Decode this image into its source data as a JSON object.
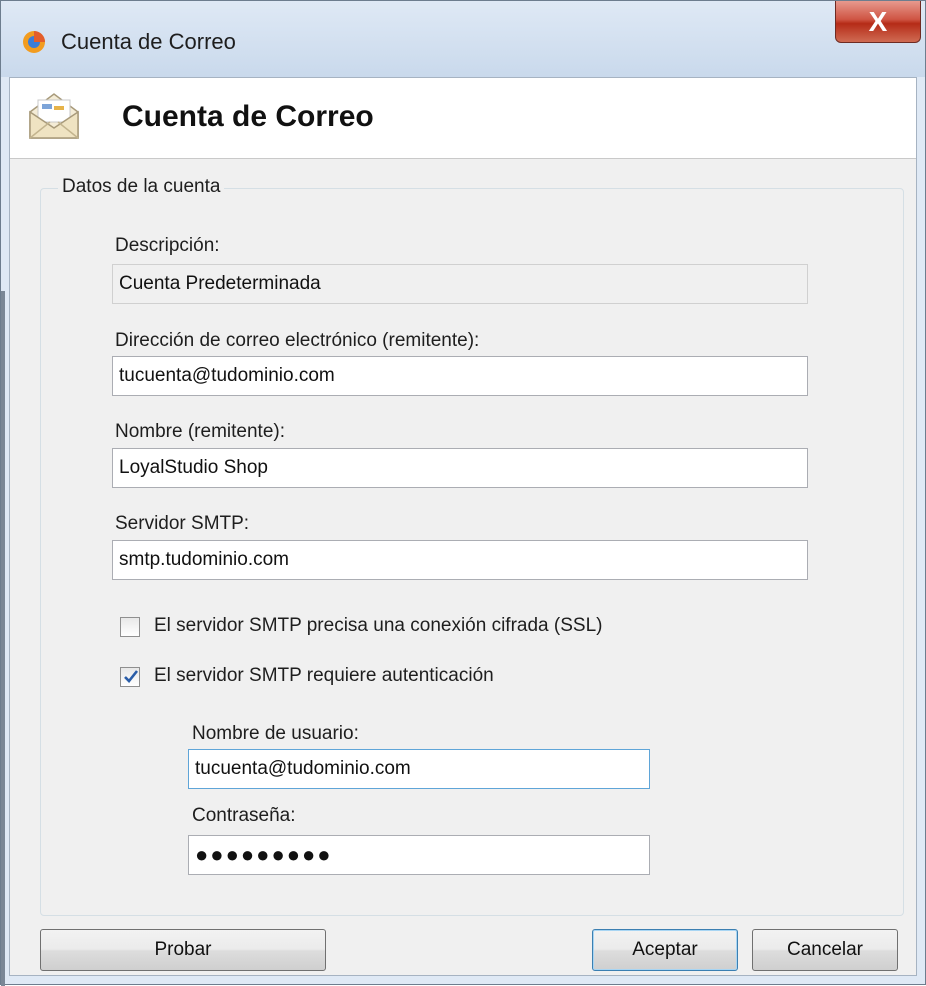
{
  "window": {
    "title": "Cuenta de Correo",
    "close_glyph": "X"
  },
  "header": {
    "title": "Cuenta de Correo",
    "icon": "envelope-icon"
  },
  "group": {
    "legend": "Datos de la cuenta"
  },
  "fields": {
    "description": {
      "label": "Descripción:",
      "value": "Cuenta Predeterminada"
    },
    "email": {
      "label": "Dirección de correo electrónico (remitente):",
      "value": "tucuenta@tudominio.com"
    },
    "name": {
      "label": "Nombre (remitente):",
      "value": "LoyalStudio Shop"
    },
    "smtp": {
      "label": "Servidor SMTP:",
      "value": "smtp.tudominio.com"
    },
    "username": {
      "label": "Nombre de usuario:",
      "value": "tucuenta@tudominio.com"
    },
    "password": {
      "label": "Contraseña:",
      "value": "●●●●●●●●●"
    }
  },
  "checks": {
    "ssl": {
      "label": "El servidor SMTP precisa una conexión cifrada (SSL)",
      "checked": false
    },
    "auth": {
      "label": "El servidor SMTP requiere autenticación",
      "checked": true
    }
  },
  "buttons": {
    "test": "Probar",
    "ok": "Aceptar",
    "cancel": "Cancelar"
  },
  "colors": {
    "titlebar": "#dfe9f5",
    "close_button": "#c7432e",
    "focus_border": "#5fa5d8",
    "check_mark": "#2a5da8"
  }
}
